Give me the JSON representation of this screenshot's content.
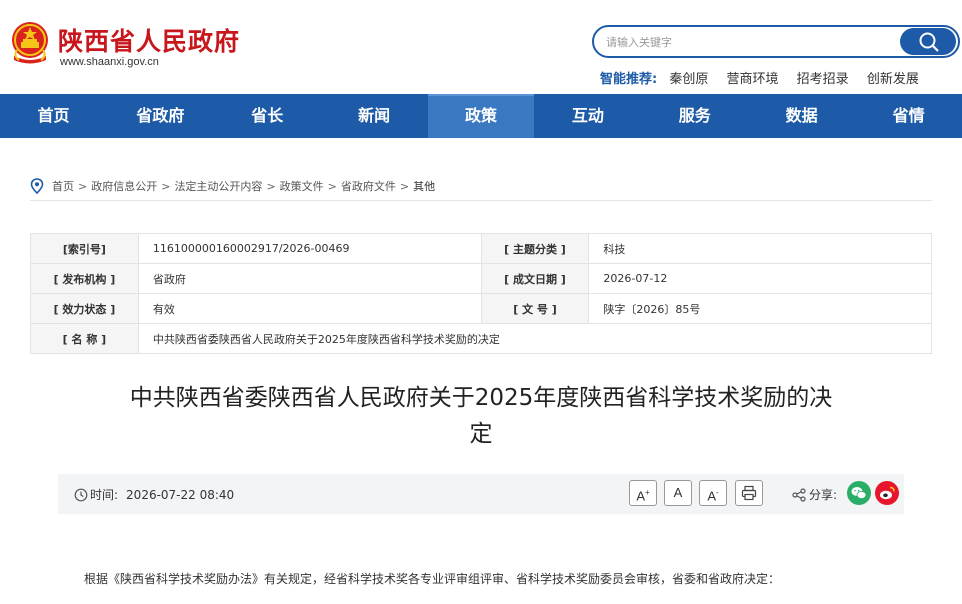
{
  "header": {
    "site_title": "陕西省人民政府",
    "site_url": "www.shaanxi.gov.cn",
    "search_placeholder": "请输入关键字",
    "recommend_label": "智能推荐:",
    "recommend_links": [
      "秦创原",
      "营商环境",
      "招考招录",
      "创新发展"
    ]
  },
  "nav": {
    "items": [
      "首页",
      "省政府",
      "省长",
      "新闻",
      "政策",
      "互动",
      "服务",
      "数据",
      "省情"
    ],
    "active": "政策"
  },
  "breadcrumb": [
    "首页",
    "政府信息公开",
    "法定主动公开内容",
    "政策文件",
    "省政府文件",
    "其他"
  ],
  "meta": {
    "index_label": "[索引号]",
    "index_value": "116100000160002917/2026-00469",
    "topic_label": "[ 主题分类 ]",
    "topic_value": "科技",
    "org_label": "[ 发布机构 ]",
    "org_value": "省政府",
    "date_label": "[ 成文日期 ]",
    "date_value": "2026-07-12",
    "status_label": "[ 效力状态 ]",
    "status_value": "有效",
    "docno_label": "[ 文 号 ]",
    "docno_value": "陕字〔2026〕85号",
    "name_label": "[ 名 称 ]",
    "name_value": "中共陕西省委陕西省人民政府关于2025年度陕西省科学技术奖励的决定"
  },
  "article": {
    "title_line1": "中共陕西省委陕西省人民政府关于2025年度陕西省科学技术奖励的决",
    "title_line2": "定",
    "time_label": "时间:",
    "time_value": "2026-07-22 08:40",
    "font_larger": "A",
    "font_larger_sup": "+",
    "font_normal": "A",
    "font_smaller": "A",
    "font_smaller_sup": "-",
    "share_label": "分享:",
    "body_first_line": "根据《陕西省科学技术奖励办法》有关规定，经省科学技术奖各专业评审组评审、省科学技术奖励委员会审核，省委和省政府决定："
  },
  "colors": {
    "brand_red": "#c8161d",
    "nav_blue": "#1d5aa7",
    "nav_active": "#3a78c2"
  }
}
